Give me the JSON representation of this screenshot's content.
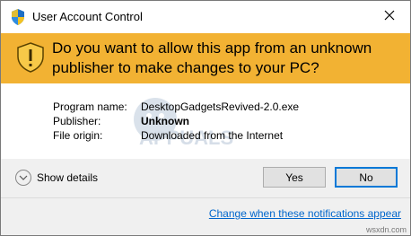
{
  "window": {
    "title": "User Account Control"
  },
  "banner": {
    "message": "Do you want to allow this app from an unknown publisher to make changes to your PC?"
  },
  "info": {
    "program_name_label": "Program name:",
    "program_name_value": "DesktopGadgetsRevived-2.0.exe",
    "publisher_label": "Publisher:",
    "publisher_value": "Unknown",
    "file_origin_label": "File origin:",
    "file_origin_value": "Downloaded from the Internet"
  },
  "footer": {
    "show_details_label": "Show details",
    "yes_label": "Yes",
    "no_label": "No",
    "notifications_link": "Change when these notifications appear"
  },
  "watermark_text": "APPUALS",
  "site_tag": "wsxdn.com",
  "colors": {
    "banner": "#f2b233",
    "footer": "#f0f0f0",
    "link": "#0066cc",
    "focus_border": "#0078d7"
  },
  "icons": {
    "title": "uac-shield-icon",
    "close": "close-icon",
    "banner": "warning-shield-icon",
    "details": "chevron-down-icon"
  }
}
